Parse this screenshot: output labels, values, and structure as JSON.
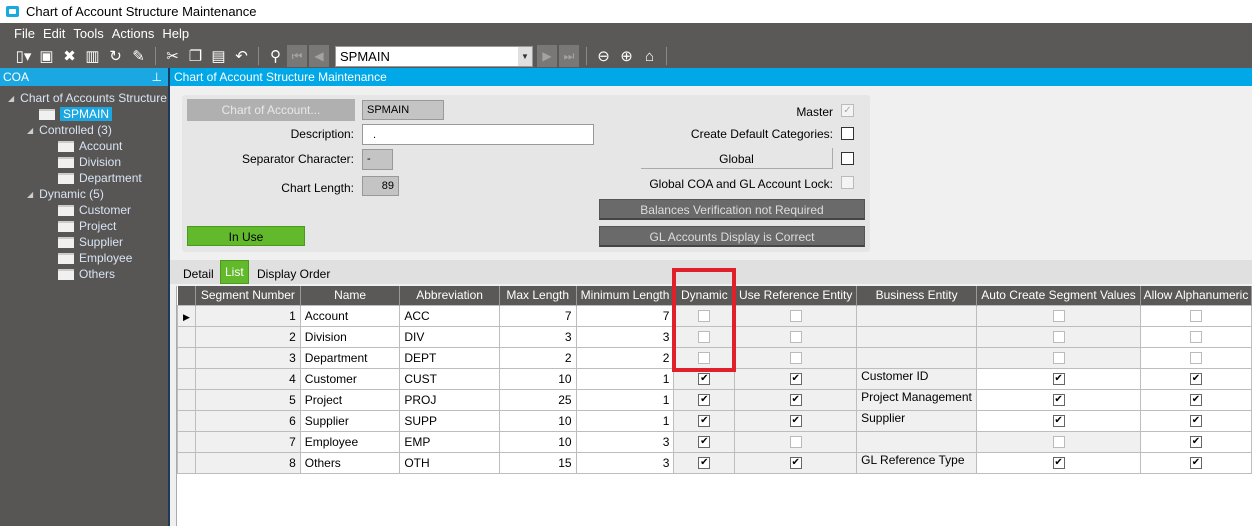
{
  "window": {
    "title": "Chart of Account Structure Maintenance"
  },
  "menu": [
    "File",
    "Edit",
    "Tools",
    "Actions",
    "Help"
  ],
  "toolbar": {
    "record_combo": "SPMAIN"
  },
  "left_panel": {
    "title": "COA",
    "tree": {
      "root": "Chart of Accounts Structure",
      "selected": "SPMAIN",
      "groups": [
        {
          "label": "Controlled (3)",
          "items": [
            "Account",
            "Division",
            "Department"
          ]
        },
        {
          "label": "Dynamic (5)",
          "items": [
            "Customer",
            "Project",
            "Supplier",
            "Employee",
            "Others"
          ]
        }
      ]
    }
  },
  "main": {
    "title": "Chart of Account Structure Maintenance"
  },
  "form": {
    "chart_of_account_button": "Chart of Account...",
    "chart_of_account_value": "SPMAIN",
    "description_label": "Description:",
    "description_value": ".",
    "separator_label": "Separator Character:",
    "separator_value": "-",
    "chart_length_label": "Chart Length:",
    "chart_length_value": "89",
    "in_use": "In Use",
    "master_label": "Master",
    "master_checked": true,
    "create_default_label": "Create Default Categories:",
    "global_button": "Global",
    "global_lock_label": "Global COA and GL Account Lock:",
    "balances_button": "Balances Verification not Required",
    "gl_display_button": "GL Accounts Display is Correct"
  },
  "tabs": [
    "Detail",
    "List",
    "Display Order"
  ],
  "active_tab": "List",
  "grid": {
    "columns": [
      "Segment Number",
      "Name",
      "Abbreviation",
      "Max Length",
      "Minimum Length",
      "Dynamic",
      "Use Reference Entity",
      "Business Entity",
      "Auto Create Segment Values",
      "Allow Alphanumeric"
    ],
    "rows": [
      {
        "num": "1",
        "name": "Account",
        "abbr": "ACC",
        "max": "7",
        "min": "7",
        "dynamic": false,
        "use_ref": false,
        "entity": "",
        "auto": false,
        "alpha": false
      },
      {
        "num": "2",
        "name": "Division",
        "abbr": "DIV",
        "max": "3",
        "min": "3",
        "dynamic": false,
        "use_ref": false,
        "entity": "",
        "auto": false,
        "alpha": false
      },
      {
        "num": "3",
        "name": "Department",
        "abbr": "DEPT",
        "max": "2",
        "min": "2",
        "dynamic": false,
        "use_ref": false,
        "entity": "",
        "auto": false,
        "alpha": false
      },
      {
        "num": "4",
        "name": "Customer",
        "abbr": "CUST",
        "max": "10",
        "min": "1",
        "dynamic": true,
        "use_ref": true,
        "entity": "Customer ID",
        "auto": true,
        "alpha": true
      },
      {
        "num": "5",
        "name": "Project",
        "abbr": "PROJ",
        "max": "25",
        "min": "1",
        "dynamic": true,
        "use_ref": true,
        "entity": "Project Management",
        "auto": true,
        "alpha": true
      },
      {
        "num": "6",
        "name": "Supplier",
        "abbr": "SUPP",
        "max": "10",
        "min": "1",
        "dynamic": true,
        "use_ref": true,
        "entity": "Supplier",
        "auto": true,
        "alpha": true
      },
      {
        "num": "7",
        "name": "Employee",
        "abbr": "EMP",
        "max": "10",
        "min": "3",
        "dynamic": true,
        "use_ref": false,
        "entity": "",
        "auto": false,
        "alpha": true
      },
      {
        "num": "8",
        "name": "Others",
        "abbr": "OTH",
        "max": "15",
        "min": "3",
        "dynamic": true,
        "use_ref": true,
        "entity": "GL Reference Type",
        "auto": true,
        "alpha": true
      }
    ]
  },
  "colors": {
    "accent": "#00a8e8",
    "in_use": "#63b92c",
    "highlight": "#e0202a",
    "chrome": "#5b5957"
  }
}
